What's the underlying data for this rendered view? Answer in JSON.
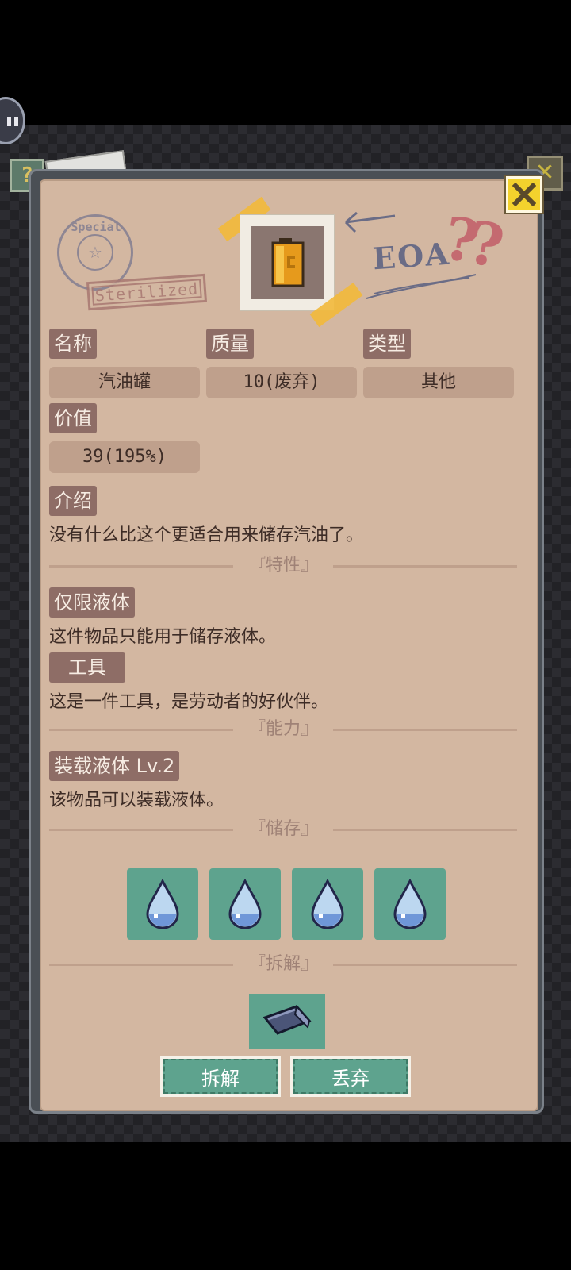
{
  "hud": {
    "pause_icon": "pause-icon",
    "help_tab": "?",
    "close_icon": "close-x-icon"
  },
  "header": {
    "stamp_ring_text": "Special",
    "stamp_center": "☆",
    "sterilized_stamp": "Sterilized",
    "eoa_mark": "EOA",
    "question_marks": "??",
    "item_icon": "gas-can-icon"
  },
  "fields": {
    "name_label": "名称",
    "name_value": "汽油罐",
    "quality_label": "质量",
    "quality_value": "10(废弃)",
    "type_label": "类型",
    "type_value": "其他",
    "value_label": "价值",
    "value_value": "39(195%)",
    "intro_label": "介绍",
    "intro_text": "没有什么比这个更适合用来储存汽油了。"
  },
  "sections": {
    "traits_title": "『特性』",
    "abilities_title": "『能力』",
    "storage_title": "『储存』",
    "dismantle_title": "『拆解』"
  },
  "traits": [
    {
      "label": "仅限液体",
      "desc": "这件物品只能用于储存液体。"
    },
    {
      "label": "工具",
      "desc": "这是一件工具，是劳动者的好伙伴。"
    }
  ],
  "abilities": [
    {
      "label": "装载液体 Lv.2",
      "desc": "该物品可以装载液体。"
    }
  ],
  "storage_slots": [
    "water-drop-icon",
    "water-drop-icon",
    "water-drop-icon",
    "water-drop-icon"
  ],
  "dismantle_result_icon": "metal-pipe-icon",
  "buttons": {
    "dismantle": "拆解",
    "discard": "丢弃"
  }
}
